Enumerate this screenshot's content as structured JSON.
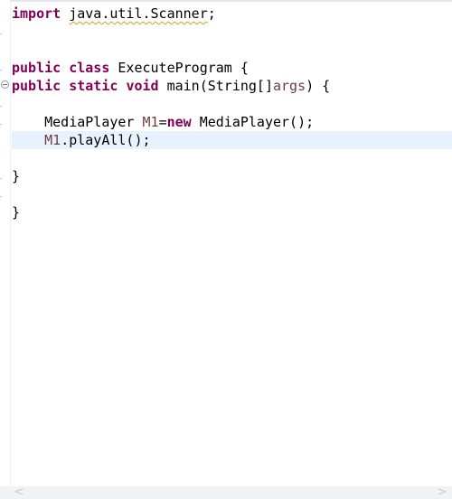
{
  "editor": {
    "lines": [
      {
        "t1": "import",
        "t2": " ",
        "t3": "java.util.Scanner",
        "t4": ";"
      },
      {
        "text": ""
      },
      {
        "text": ""
      },
      {
        "k1": "public",
        "s1": " ",
        "k2": "class",
        "rest": " ExecuteProgram {"
      },
      {
        "k1": "public",
        "s1": " ",
        "k2": "static",
        "s2": " ",
        "k3": "void",
        "rest1": " main(String[]",
        "var": "args",
        "rest2": ") {"
      },
      {
        "text": ""
      },
      {
        "indent": "    ",
        "t1": "MediaPlayer ",
        "var": "M1",
        "t2": "=",
        "kw": "new",
        "t3": " MediaPlayer();"
      },
      {
        "indent": "    ",
        "var": "M1",
        "t1": ".playAll();"
      },
      {
        "text": ""
      },
      {
        "text": "}"
      },
      {
        "text": ""
      },
      {
        "text": "}"
      }
    ]
  },
  "scrollbar": {
    "left_arrow": "<",
    "right_arrow": ">"
  }
}
